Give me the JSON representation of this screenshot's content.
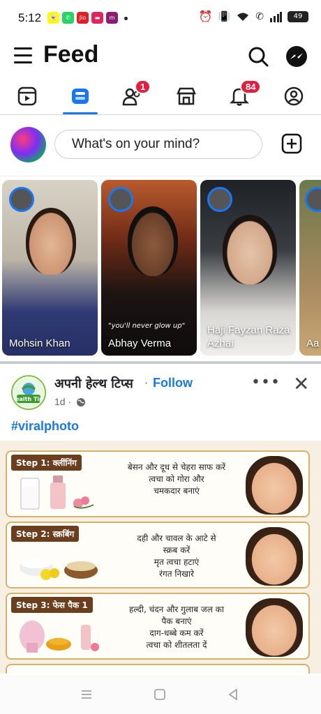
{
  "status_bar": {
    "time": "5:12",
    "battery": "49",
    "app_icons": [
      {
        "name": "snapchat",
        "color": "#fffc00",
        "glyph": "👻"
      },
      {
        "name": "whatsapp",
        "color": "#25d366",
        "glyph": "✆"
      },
      {
        "name": "jio",
        "color": "#e31e24",
        "glyph": "Jio"
      },
      {
        "name": "app-red",
        "color": "#e0245e",
        "glyph": "▬"
      },
      {
        "name": "meesho",
        "color": "#8b1e6f",
        "glyph": "m"
      }
    ]
  },
  "header": {
    "title": "Feed"
  },
  "tabs": {
    "friends_badge": "1",
    "notifications_badge": "84"
  },
  "composer": {
    "placeholder": "What's on your mind?"
  },
  "stories": [
    {
      "name": "Mohsin Khan",
      "caption": ""
    },
    {
      "name": "Abhay Verma",
      "caption": "\"you'll never glow up\""
    },
    {
      "name": "Haji Fayzan Raza Azhai",
      "caption": ""
    },
    {
      "name": "Aa",
      "caption": ""
    }
  ],
  "post": {
    "page_name": "अपनी हेल्थ टिप्स",
    "separator": "·",
    "follow_label": "Follow",
    "time": "1d ·",
    "more": "•••",
    "close": "✕",
    "hashtag": "#viralphoto",
    "logo_text": "Health Tips",
    "steps": [
      {
        "label": "Step 1: क्लींनिंग",
        "lines": [
          "बेसन और दूध से चेहरा साफ करें",
          "त्वचा को गोरा और",
          "चमकदार बनाएं"
        ]
      },
      {
        "label": "Step 2: स्क्रबिंग",
        "lines": [
          "दही और चावल के आटे से",
          "स्क्रब करें",
          "मृत त्वचा हटाएं",
          "रंगत निखारे"
        ]
      },
      {
        "label": "Step 3: फेस पैक 1",
        "lines": [
          "हल्दी, चंदन और गुलाब जल का",
          "पैक बनाएं",
          "दाग-धब्बे कम करें",
          "त्वचा को शीतलता दें"
        ]
      }
    ]
  },
  "colors": {
    "accent": "#1877f2",
    "badge": "#e41e3f",
    "step_border": "#d4b26e",
    "step_label": "#6b3f1d"
  }
}
